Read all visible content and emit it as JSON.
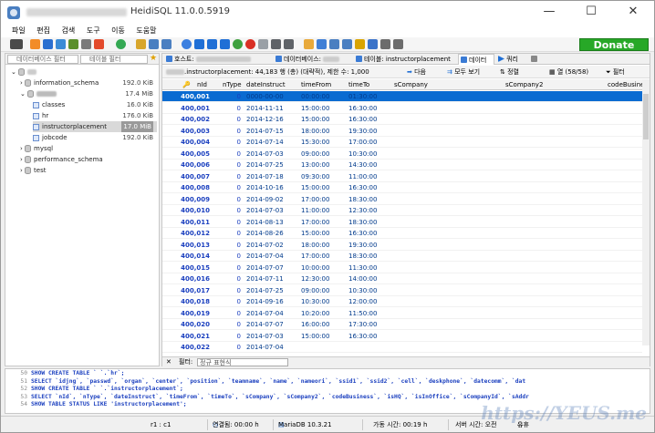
{
  "window": {
    "title": "HeidiSQL 11.0.0.5919",
    "minimize": "—",
    "maximize": "☐",
    "close": "✕"
  },
  "menu": [
    "파일",
    "편집",
    "검색",
    "도구",
    "이동",
    "도움말"
  ],
  "toolbar": {
    "donate_label": "Donate"
  },
  "left_panel": {
    "db_filter_placeholder": "데이터베이스 필터",
    "table_filter_placeholder": "테이블 필터",
    "tree": [
      {
        "name": "information_schema",
        "size": "192.0 KiB"
      },
      {
        "name": "",
        "size": "17.4 MiB"
      },
      {
        "name": "classes",
        "size": "16.0 KiB"
      },
      {
        "name": "hr",
        "size": "176.0 KiB"
      },
      {
        "name": "instructorplacement",
        "size": "17.0 MiB"
      },
      {
        "name": "jobcode",
        "size": "192.0 KiB"
      },
      {
        "name": "mysql",
        "size": ""
      },
      {
        "name": "performance_schema",
        "size": ""
      },
      {
        "name": "test",
        "size": ""
      }
    ]
  },
  "tabs": {
    "host": "호스트:",
    "database": "데이터베이스:",
    "table": "테이블: instructorplacement",
    "data": "데이터",
    "query": "쿼리"
  },
  "infobar": {
    "summary": ".instructorplacement: 44,183 행 (총) (대략적), 제한 수: 1,000",
    "next": "다음",
    "show_all": "모두 보기",
    "sort": "정렬",
    "columns": "열 (58/58)",
    "filter": "필터"
  },
  "grid": {
    "columns": [
      "nId",
      "nType",
      "dateInstruct",
      "timeFrom",
      "timeTo",
      "sCompany",
      "sCompany2",
      "codeBusines"
    ],
    "rows": [
      [
        "400,001",
        "0",
        "0000-00-00",
        "00:00:00",
        "01:30:00"
      ],
      [
        "400,001",
        "0",
        "2014-11-11",
        "15:00:00",
        "16:30:00"
      ],
      [
        "400,002",
        "0",
        "2014-12-16",
        "15:00:00",
        "16:30:00"
      ],
      [
        "400,003",
        "0",
        "2014-07-15",
        "18:00:00",
        "19:30:00"
      ],
      [
        "400,004",
        "0",
        "2014-07-14",
        "15:30:00",
        "17:00:00"
      ],
      [
        "400,005",
        "0",
        "2014-07-03",
        "09:00:00",
        "10:30:00"
      ],
      [
        "400,006",
        "0",
        "2014-07-25",
        "13:00:00",
        "14:30:00"
      ],
      [
        "400,007",
        "0",
        "2014-07-18",
        "09:30:00",
        "11:00:00"
      ],
      [
        "400,008",
        "0",
        "2014-10-16",
        "15:00:00",
        "16:30:00"
      ],
      [
        "400,009",
        "0",
        "2014-09-02",
        "17:00:00",
        "18:30:00"
      ],
      [
        "400,010",
        "0",
        "2014-07-03",
        "11:00:00",
        "12:30:00"
      ],
      [
        "400,011",
        "0",
        "2014-08-13",
        "17:00:00",
        "18:30:00"
      ],
      [
        "400,012",
        "0",
        "2014-08-26",
        "15:00:00",
        "16:30:00"
      ],
      [
        "400,013",
        "0",
        "2014-07-02",
        "18:00:00",
        "19:30:00"
      ],
      [
        "400,014",
        "0",
        "2014-07-04",
        "17:00:00",
        "18:30:00"
      ],
      [
        "400,015",
        "0",
        "2014-07-07",
        "10:00:00",
        "11:30:00"
      ],
      [
        "400,016",
        "0",
        "2014-07-11",
        "12:30:00",
        "14:00:00"
      ],
      [
        "400,017",
        "0",
        "2014-07-25",
        "09:00:00",
        "10:30:00"
      ],
      [
        "400,018",
        "0",
        "2014-09-16",
        "10:30:00",
        "12:00:00"
      ],
      [
        "400,019",
        "0",
        "2014-07-04",
        "10:20:00",
        "11:50:00"
      ],
      [
        "400,020",
        "0",
        "2014-07-07",
        "16:00:00",
        "17:30:00"
      ],
      [
        "400,021",
        "0",
        "2014-07-03",
        "15:00:00",
        "16:30:00"
      ],
      [
        "400,022",
        "0",
        "2014-07-04",
        "",
        ""
      ]
    ]
  },
  "filterbar": {
    "label": "필터:",
    "placeholder": "정규 표현식",
    "close": "✕"
  },
  "sqllog": [
    {
      "ln": "50",
      "text": "SHOW CREATE TABLE `        `.`hr`;"
    },
    {
      "ln": "51",
      "text": "SELECT `idjng`, `passwd`, `organ`, `center`, `position`, `teamname`, `name`, `nameori`, `ssid1`, `ssid2`, `cell`, `deskphone`, `datecomm`, `dat"
    },
    {
      "ln": "52",
      "text": "SHOW CREATE TABLE `        `.`instructorplacement`;"
    },
    {
      "ln": "53",
      "text": "SELECT `nId`, `nType`, `dateInstruct`, `timeFrom`, `timeTo`, `sCompany`, `sCompany2`, `codeBusiness`, `isHQ`, `isInOffice`, `sCompanyId`, `sAddr"
    },
    {
      "ln": "54",
      "text": "SHOW TABLE STATUS LIKE 'instructorplacement';"
    }
  ],
  "status": {
    "cursor": "r1 : c1",
    "connected": "연결됨: 00:00 h",
    "server": "MariaDB 10.3.21",
    "uptime": "가동 시간: 00:19 h",
    "server_time": "서버 시간: 오전",
    "idle": "유휴"
  },
  "watermark": "https://YEUS.me"
}
